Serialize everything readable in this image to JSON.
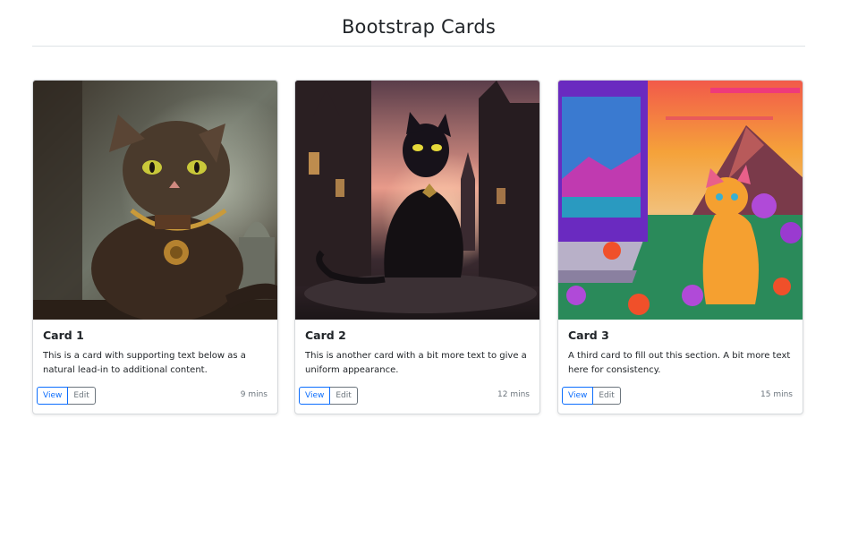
{
  "header": {
    "title": "Bootstrap Cards"
  },
  "cards": [
    {
      "title": "Card 1",
      "text": "This is a card with supporting text below as a natural lead-in to additional content.",
      "view_label": "View",
      "edit_label": "Edit",
      "time": "9 mins",
      "image_alt": "cat with gold chain collar"
    },
    {
      "title": "Card 2",
      "text": "This is another card with a bit more text to give a uniform appearance.",
      "view_label": "View",
      "edit_label": "Edit",
      "time": "12 mins",
      "image_alt": "black cat in gothic street at sunset"
    },
    {
      "title": "Card 3",
      "text": "A third card to fill out this section. A bit more text here for consistency.",
      "view_label": "View",
      "edit_label": "Edit",
      "time": "15 mins",
      "image_alt": "colorful pixel art cat with computer"
    }
  ],
  "colors": {
    "primary": "#0d6efd",
    "secondary": "#6c757d",
    "text": "#212529",
    "border": "#dee2e6"
  }
}
